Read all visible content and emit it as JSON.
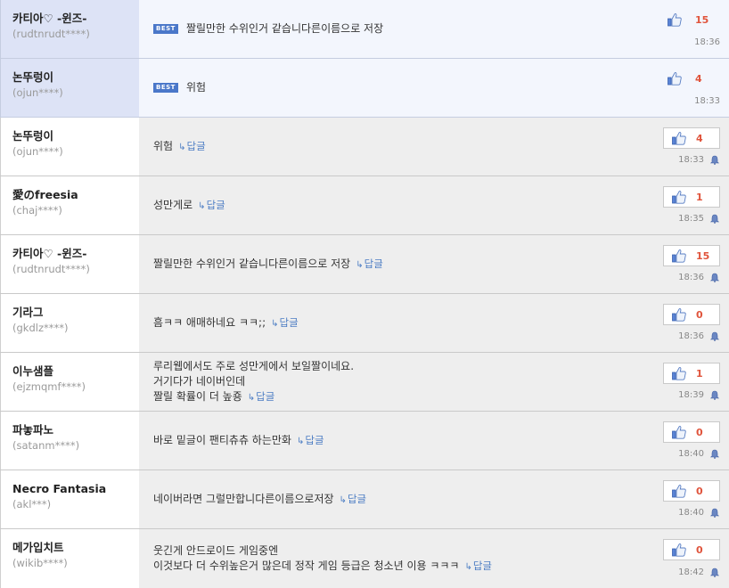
{
  "best_badge": "BEST",
  "reply_label": "답글",
  "comments": [
    {
      "nick": "카티아♡ -윈즈-",
      "uid": "(rudtnrudt****)",
      "best": true,
      "lines": [
        "짤릴만한 수위인거 같습니다른이름으로 저장"
      ],
      "likes": "15",
      "time": "18:36"
    },
    {
      "nick": "논뚜렁이",
      "uid": "(ojun****)",
      "best": true,
      "lines": [
        "위험"
      ],
      "likes": "4",
      "time": "18:33"
    },
    {
      "nick": "논뚜렁이",
      "uid": "(ojun****)",
      "best": false,
      "lines": [
        "위험"
      ],
      "likes": "4",
      "time": "18:33"
    },
    {
      "nick": "愛のfreesia",
      "uid": "(chaj****)",
      "best": false,
      "lines": [
        "성만게로"
      ],
      "likes": "1",
      "time": "18:35"
    },
    {
      "nick": "카티아♡ -윈즈-",
      "uid": "(rudtnrudt****)",
      "best": false,
      "lines": [
        "짤릴만한 수위인거 같습니다른이름으로 저장"
      ],
      "likes": "15",
      "time": "18:36"
    },
    {
      "nick": "기라그",
      "uid": "(gkdlz****)",
      "best": false,
      "lines": [
        "흠ㅋㅋ 애매하네요 ㅋㅋ;;"
      ],
      "likes": "0",
      "time": "18:36"
    },
    {
      "nick": "이누샘플",
      "uid": "(ejzmqmf****)",
      "best": false,
      "lines": [
        "루리웹에서도 주로 성만게에서 보일짤이네요.",
        "거기다가 네이버인데",
        "짤릴 확률이 더 높죵"
      ],
      "likes": "1",
      "time": "18:39"
    },
    {
      "nick": "파놓파노",
      "uid": "(satanm****)",
      "best": false,
      "lines": [
        "바로 밑글이 팬티츄츄 하는만화"
      ],
      "likes": "0",
      "time": "18:40"
    },
    {
      "nick": "Necro Fantasia",
      "uid": "(akl***)",
      "best": false,
      "lines": [
        "네이버라면 그럴만합니다른이름으로저장"
      ],
      "likes": "0",
      "time": "18:40"
    },
    {
      "nick": "메가입치트",
      "uid": "(wikib****)",
      "best": false,
      "lines": [
        "웃긴게 안드로이드 게임중엔",
        "이것보다 더 수위높은거 많은데 정작 게임 등급은 청소년 이용 ㅋㅋㅋ"
      ],
      "likes": "0",
      "time": "18:42"
    }
  ],
  "colors": {
    "accent": "#4a77c9",
    "likes": "#e0543c",
    "reply": "#4d7ec4"
  },
  "icons": {
    "like": "thumbs-up-icon",
    "report": "bell-icon",
    "reply": "reply-arrow-icon"
  }
}
